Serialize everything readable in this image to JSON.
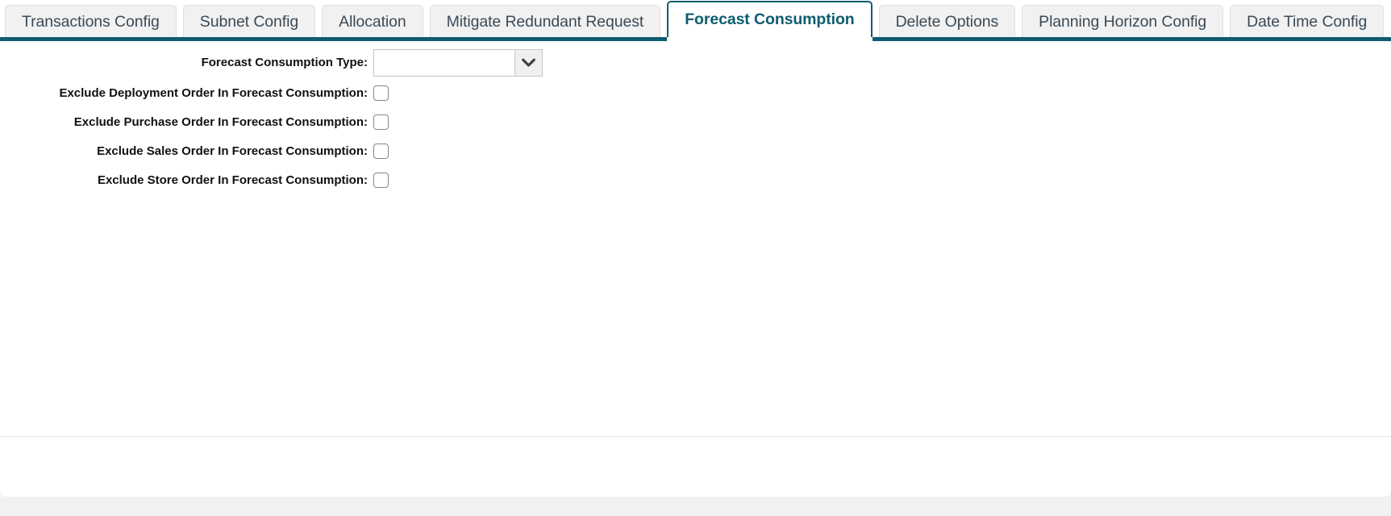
{
  "theme": {
    "accent": "#0e5c70",
    "tab_inactive_bg": "#f1f1f1",
    "tab_inactive_text": "#3b4a57",
    "panel_bg": "#ffffff",
    "page_bg": "#f1f1f1",
    "label_text": "#111111",
    "control_border": "#c6c6c6",
    "checkbox_border": "#868686"
  },
  "tabs": [
    {
      "label": "Transactions Config",
      "active": false
    },
    {
      "label": "Subnet Config",
      "active": false
    },
    {
      "label": "Allocation",
      "active": false
    },
    {
      "label": "Mitigate Redundant Request",
      "active": false
    },
    {
      "label": "Forecast Consumption",
      "active": true
    },
    {
      "label": "Delete Options",
      "active": false
    },
    {
      "label": "Planning Horizon Config",
      "active": false
    },
    {
      "label": "Date Time Config",
      "active": false
    }
  ],
  "form": {
    "select_field": {
      "label": "Forecast Consumption Type:",
      "value": "",
      "placeholder": "",
      "arrow_icon": "chevron-down-icon"
    },
    "checkboxes": [
      {
        "label": "Exclude Deployment Order In Forecast Consumption:",
        "checked": false
      },
      {
        "label": "Exclude Purchase Order In Forecast Consumption:",
        "checked": false
      },
      {
        "label": "Exclude Sales Order In Forecast Consumption:",
        "checked": false
      },
      {
        "label": "Exclude Store Order In Forecast Consumption:",
        "checked": false
      }
    ]
  }
}
